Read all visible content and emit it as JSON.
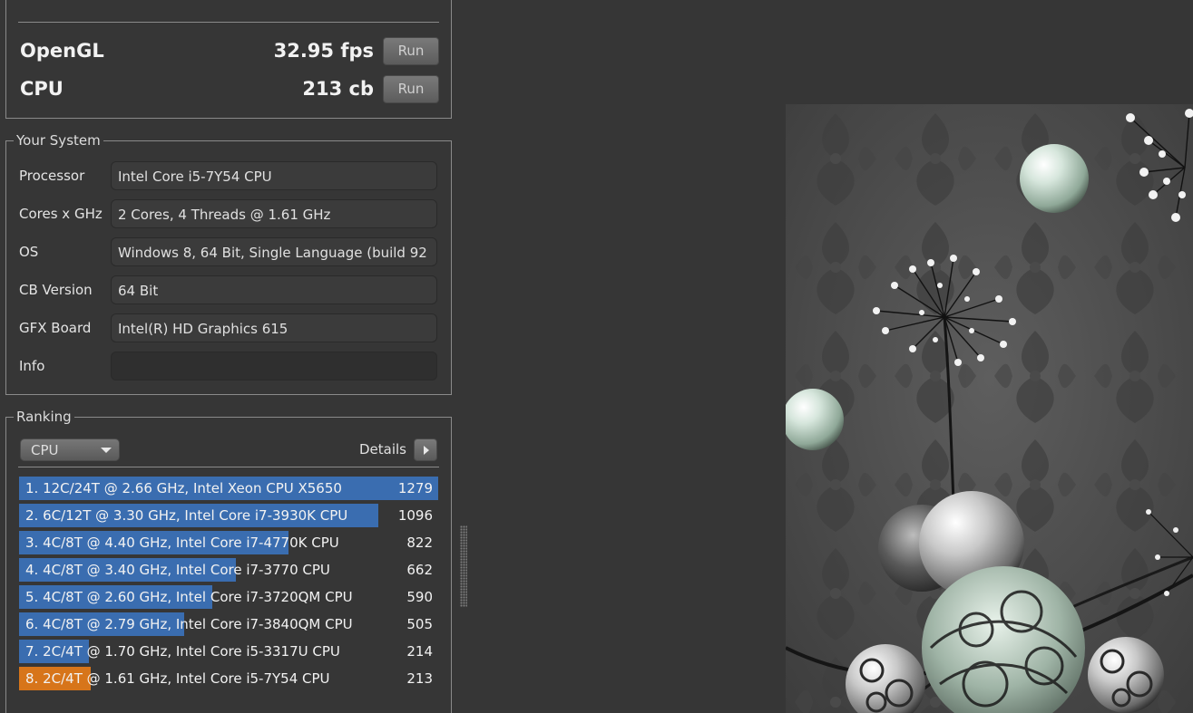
{
  "scores": {
    "opengl": {
      "label": "OpenGL",
      "value": "32.95 fps",
      "run_label": "Run"
    },
    "cpu": {
      "label": "CPU",
      "value": "213 cb",
      "run_label": "Run"
    }
  },
  "system": {
    "title": "Your System",
    "rows": [
      {
        "label": "Processor",
        "value": "Intel Core i5-7Y54 CPU"
      },
      {
        "label": "Cores x GHz",
        "value": "2 Cores, 4 Threads @ 1.61 GHz"
      },
      {
        "label": "OS",
        "value": "Windows 8, 64 Bit, Single Language (build 92"
      },
      {
        "label": "CB Version",
        "value": "64 Bit"
      },
      {
        "label": "GFX Board",
        "value": "Intel(R) HD Graphics 615"
      },
      {
        "label": "Info",
        "value": ""
      }
    ]
  },
  "ranking": {
    "title": "Ranking",
    "selected": "CPU",
    "details_label": "Details",
    "max_score": 1279,
    "entries": [
      {
        "label": "1. 12C/24T @ 2.66 GHz, Intel Xeon CPU X5650",
        "score": 1279,
        "current": false
      },
      {
        "label": "2. 6C/12T @ 3.30 GHz,  Intel Core i7-3930K CPU",
        "score": 1096,
        "current": false
      },
      {
        "label": "3. 4C/8T @ 4.40 GHz, Intel Core i7-4770K CPU",
        "score": 822,
        "current": false
      },
      {
        "label": "4. 4C/8T @ 3.40 GHz,  Intel Core i7-3770 CPU",
        "score": 662,
        "current": false
      },
      {
        "label": "5. 4C/8T @ 2.60 GHz, Intel Core i7-3720QM CPU",
        "score": 590,
        "current": false
      },
      {
        "label": "6. 4C/8T @ 2.79 GHz,  Intel Core i7-3840QM CPU",
        "score": 505,
        "current": false
      },
      {
        "label": "7. 2C/4T @ 1.70 GHz,  Intel Core i5-3317U CPU",
        "score": 214,
        "current": false
      },
      {
        "label": "8. 2C/4T @ 1.61 GHz, Intel Core i5-7Y54 CPU",
        "score": 213,
        "current": true
      }
    ]
  },
  "colors": {
    "rank_bar": "#3a6db0",
    "rank_bar_current": "#d7751a",
    "background": "#363636"
  }
}
